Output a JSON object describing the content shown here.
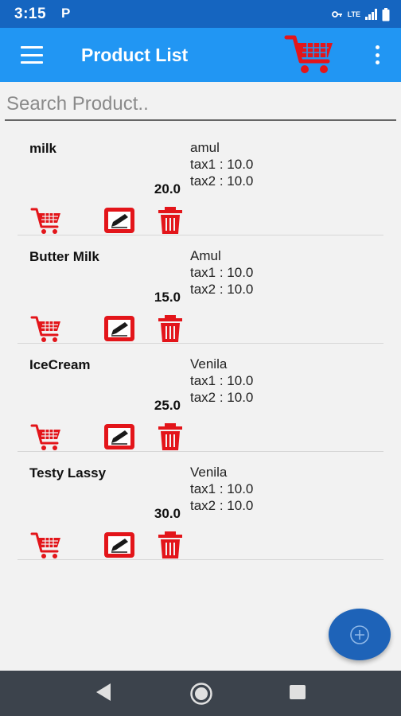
{
  "status_bar": {
    "time": "3:15",
    "app_icon": "P",
    "network": "LTE",
    "icons": [
      "key-icon",
      "signal-icon",
      "battery-icon"
    ]
  },
  "app_bar": {
    "title": "Product List",
    "menu_icon": "hamburger-icon",
    "cart_icon": "cart-icon",
    "overflow_icon": "more-vert-icon"
  },
  "search": {
    "placeholder": "Search Product.."
  },
  "products": [
    {
      "name": "milk",
      "price": "20.0",
      "brand": "amul",
      "tax1": "tax1 : 10.0",
      "tax2": "tax2 : 10.0"
    },
    {
      "name": "Butter Milk",
      "price": "15.0",
      "brand": "Amul",
      "tax1": "tax1 : 10.0",
      "tax2": "tax2 : 10.0"
    },
    {
      "name": "IceCream",
      "price": "25.0",
      "brand": "Venila",
      "tax1": "tax1 : 10.0",
      "tax2": "tax2 : 10.0"
    },
    {
      "name": "Testy Lassy",
      "price": "30.0",
      "brand": "Venila",
      "tax1": "tax1 : 10.0",
      "tax2": "tax2 : 10.0"
    }
  ],
  "item_actions": [
    "add-to-cart-icon",
    "edit-icon",
    "delete-icon"
  ],
  "fab": {
    "icon": "add-circle-icon"
  },
  "nav_bar": {
    "icons": [
      "back-icon",
      "home-icon",
      "recents-icon"
    ]
  },
  "colors": {
    "status_bar": "#1565c0",
    "app_bar": "#2196f3",
    "accent_red": "#e3151a",
    "fab": "#1e63b8",
    "nav_bar": "#3c434c"
  }
}
